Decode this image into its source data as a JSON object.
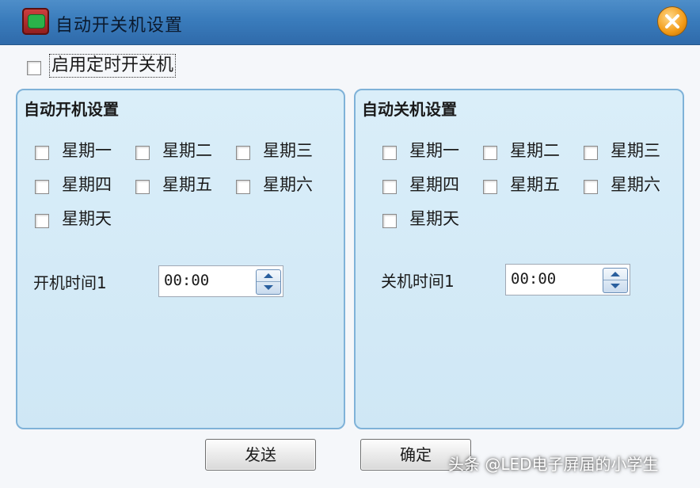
{
  "window": {
    "title": "自动开关机设置"
  },
  "enable": {
    "label": "启用定时开关机",
    "checked": false
  },
  "power_on": {
    "title": "自动开机设置",
    "days": [
      "星期一",
      "星期二",
      "星期三",
      "星期四",
      "星期五",
      "星期六",
      "星期天"
    ],
    "time_label": "开机时间1",
    "time_value": "00:00"
  },
  "power_off": {
    "title": "自动关机设置",
    "days": [
      "星期一",
      "星期二",
      "星期三",
      "星期四",
      "星期五",
      "星期六",
      "星期天"
    ],
    "time_label": "关机时间1",
    "time_value": "00:00"
  },
  "buttons": {
    "send": "发送",
    "ok": "确定"
  },
  "watermark": "头条 @LED电子屏届的小学生"
}
